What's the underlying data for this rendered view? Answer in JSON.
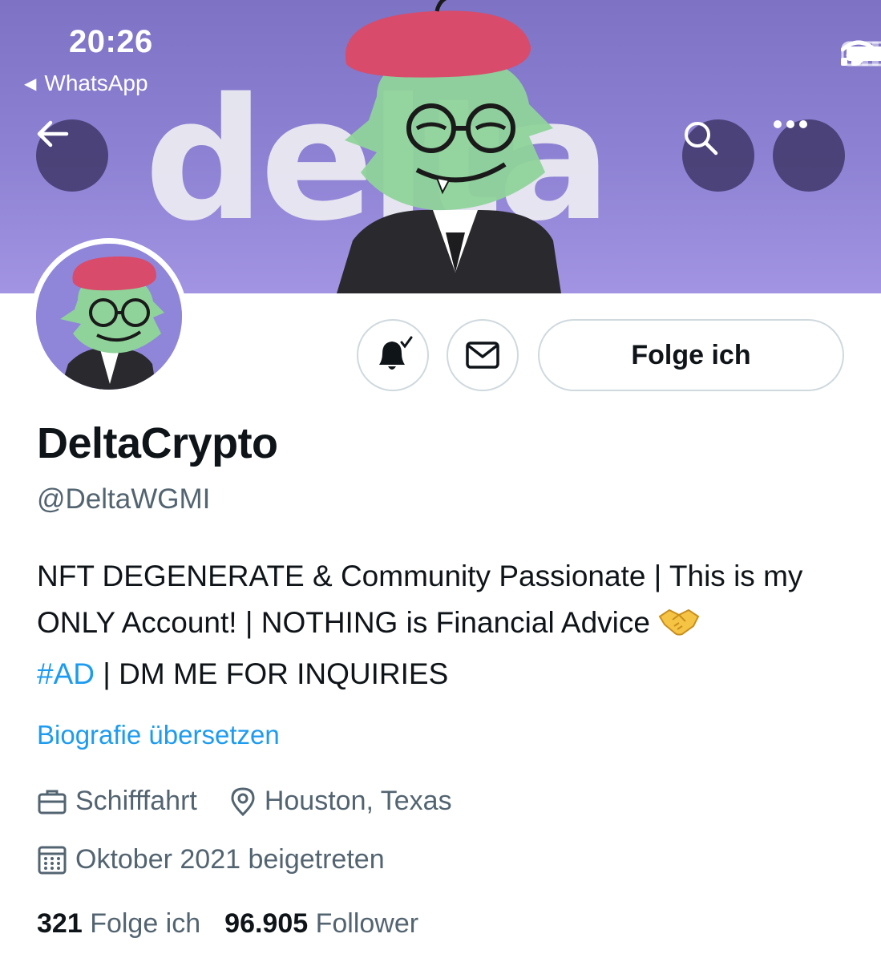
{
  "status_bar": {
    "time": "20:26",
    "back_app": "WhatsApp"
  },
  "banner": {
    "wordmark": "delta",
    "colors": {
      "top": "#7d72c4",
      "bottom": "#a294e2",
      "beret": "#d94b6a",
      "face": "#8fd39a"
    }
  },
  "icons": {
    "back": "arrow-left-icon",
    "search": "search-icon",
    "more": "more-horizontal-icon",
    "bell": "bell-subscribed-icon",
    "mail": "mail-icon",
    "job": "briefcase-icon",
    "location": "location-pin-icon",
    "joined": "calendar-icon"
  },
  "actions": {
    "follow_label": "Folge ich"
  },
  "profile": {
    "name": "DeltaCrypto",
    "handle": "@DeltaWGMI",
    "bio_part1": "NFT DEGENERATE & Community Passionate | This is my ONLY Account! | NOTHING is Financial Advice ",
    "bio_emoji": "🤝",
    "bio_hashtag": "#AD",
    "bio_part2": " | DM ME FOR INQUIRIES",
    "translate_label": "Biografie übersetzen",
    "profession": "Schifffahrt",
    "location": "Houston, Texas",
    "joined": "Oktober 2021 beigetreten"
  },
  "stats": {
    "following_count": "321",
    "following_label": "Folge ich",
    "followers_count": "96.905",
    "followers_label": "Follower"
  },
  "colors": {
    "accent": "#1d9bf0",
    "text": "#0f1419",
    "secondary": "#536471",
    "border": "#cfd9de"
  }
}
